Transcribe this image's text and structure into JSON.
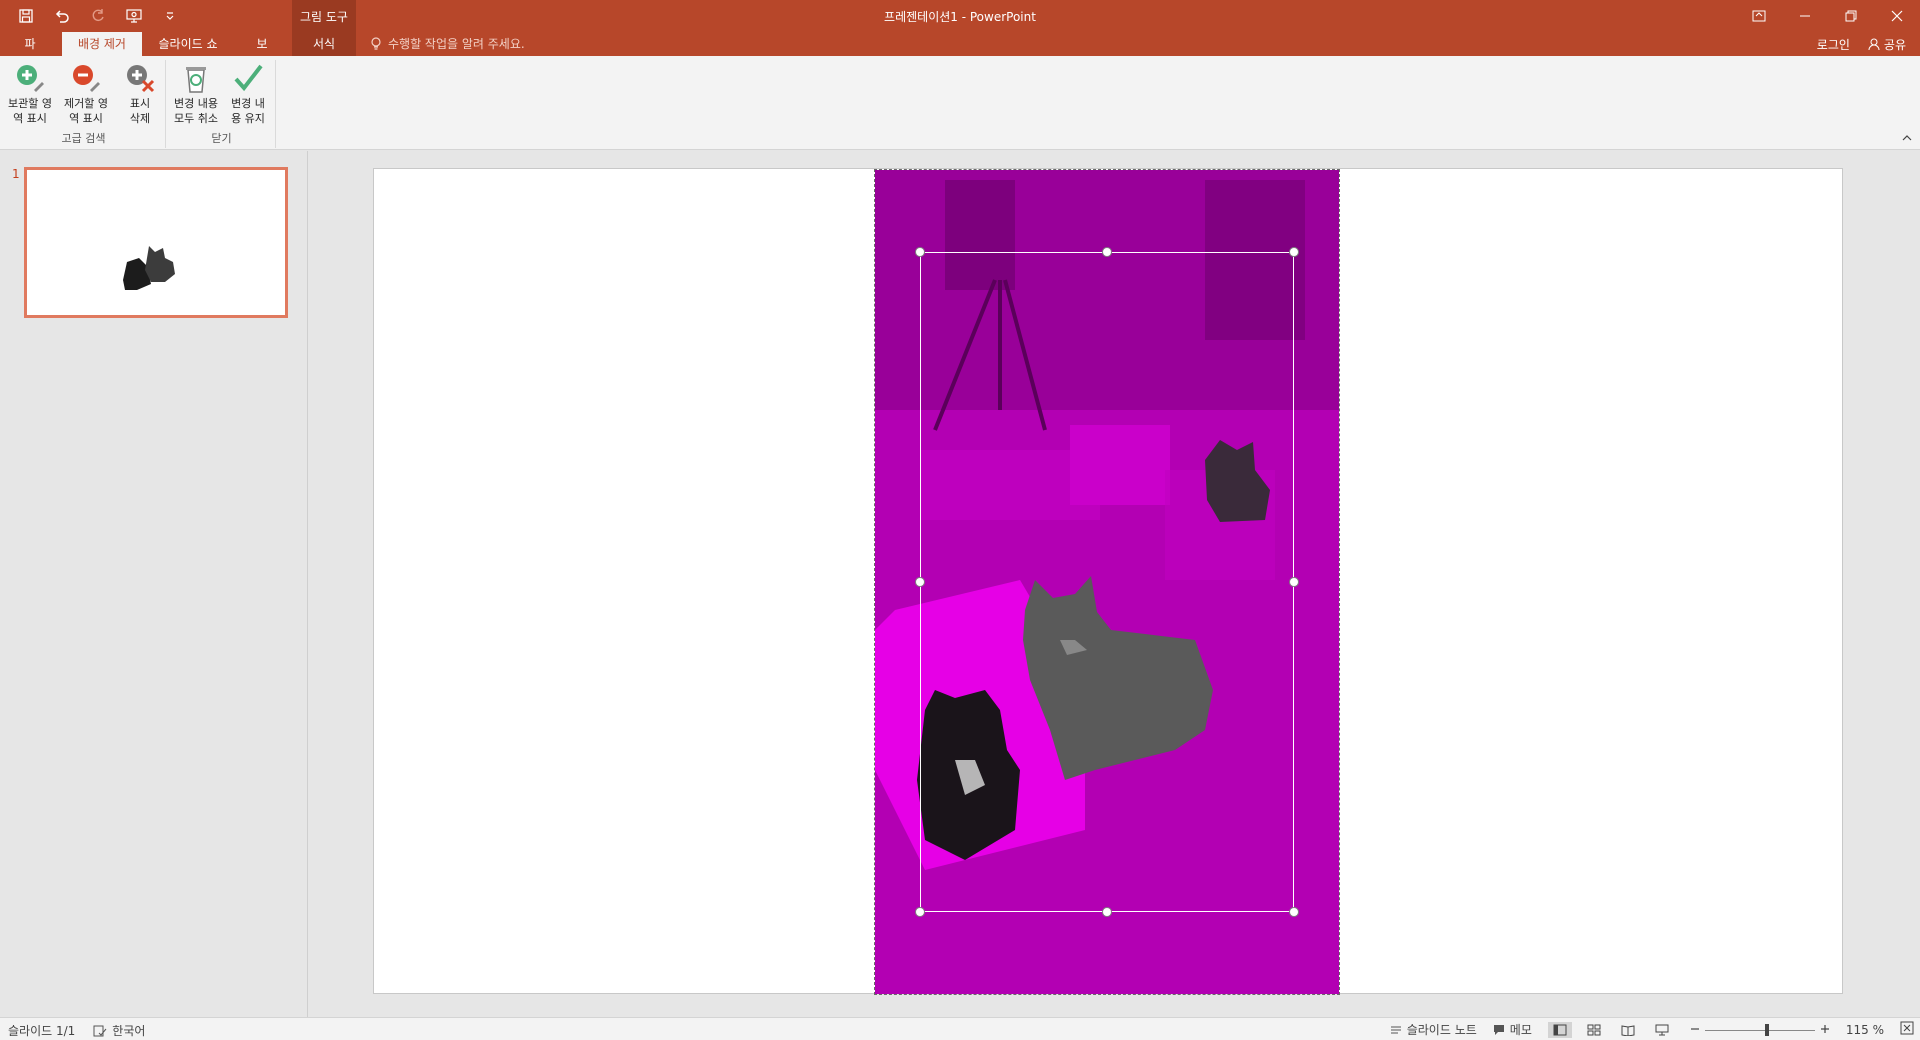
{
  "app": {
    "window_title": "프레젠테이션1 - PowerPoint",
    "context_group_title": "그림 도구"
  },
  "tabs": [
    {
      "label": "파일"
    },
    {
      "label": "배경 제거",
      "active": true
    },
    {
      "label": "슬라이드 쇼"
    },
    {
      "label": "보기"
    },
    {
      "label": "서식",
      "context": true
    }
  ],
  "tellme": {
    "placeholder": "수행할 작업을 알려 주세요."
  },
  "account": {
    "login": "로그인",
    "share": "공유"
  },
  "ribbon": {
    "groups": [
      {
        "label": "고급 검색",
        "buttons": [
          {
            "line1": "보관할 영",
            "line2": "역 표시",
            "icon": "mark-keep-icon"
          },
          {
            "line1": "제거할 영",
            "line2": "역 표시",
            "icon": "mark-remove-icon"
          },
          {
            "line1": "표시",
            "line2": "삭제",
            "icon": "delete-mark-icon"
          }
        ]
      },
      {
        "label": "닫기",
        "buttons": [
          {
            "line1": "변경 내용",
            "line2": "모두 취소",
            "icon": "discard-changes-icon"
          },
          {
            "line1": "변경 내",
            "line2": "용 유지",
            "icon": "keep-changes-icon"
          }
        ]
      }
    ]
  },
  "thumbnails": [
    {
      "number": "1"
    }
  ],
  "statusbar": {
    "slide_counter": "슬라이드 1/1",
    "language": "한국어",
    "notes": "슬라이드 노트",
    "comments": "메모",
    "zoom": "115 %"
  },
  "colors": {
    "accent": "#b7472a",
    "context_tab": "#9a3a21",
    "removal_overlay": "#c800c8"
  }
}
